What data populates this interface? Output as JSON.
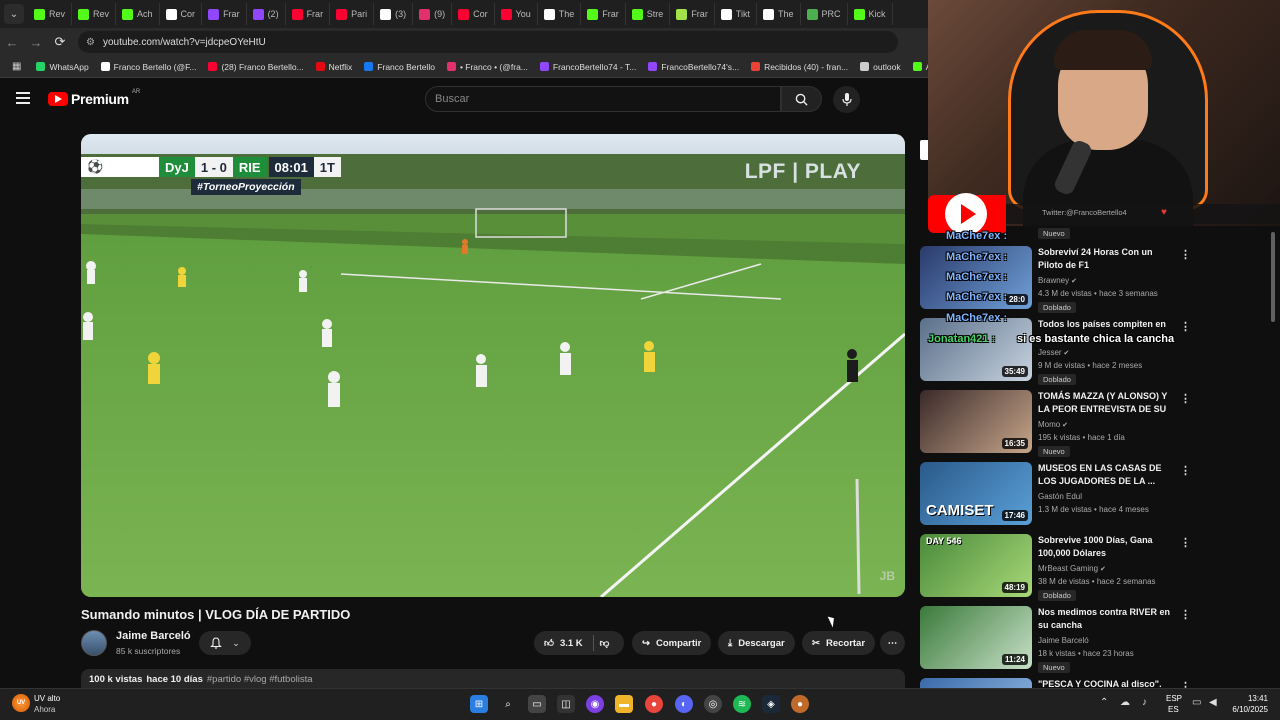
{
  "browser": {
    "tabs": [
      {
        "label": "Rev",
        "color": "#53fc18"
      },
      {
        "label": "Rev",
        "color": "#53fc18"
      },
      {
        "label": "Ach",
        "color": "#53fc18"
      },
      {
        "label": "Cor",
        "color": "#ffffff"
      },
      {
        "label": "Frar",
        "color": "#9146ff"
      },
      {
        "label": "(2)",
        "color": "#9146ff"
      },
      {
        "label": "Frar",
        "color": "#ff0033"
      },
      {
        "label": "Pari",
        "color": "#ff0033"
      },
      {
        "label": "(3)",
        "color": "#ffffff"
      },
      {
        "label": "(9)",
        "color": "#e1306c"
      },
      {
        "label": "Cor",
        "color": "#ff0033"
      },
      {
        "label": "You",
        "color": "#ff0033"
      },
      {
        "label": "The",
        "color": "#ffffff"
      },
      {
        "label": "Frar",
        "color": "#53fc18"
      },
      {
        "label": "Stre",
        "color": "#53fc18"
      },
      {
        "label": "Frar",
        "color": "#a4e24a"
      },
      {
        "label": "Tikt",
        "color": "#ffffff"
      },
      {
        "label": "The",
        "color": "#ffffff"
      },
      {
        "label": "PRC",
        "color": "#4caf50"
      },
      {
        "label": "Kick",
        "color": "#53fc18"
      }
    ],
    "url": "youtube.com/watch?v=jdcpeOYeHtU",
    "bookmarks": [
      {
        "label": "WhatsApp",
        "color": "#25d366"
      },
      {
        "label": "Franco Bertello (@F...",
        "color": "#ffffff"
      },
      {
        "label": "(28) Franco Bertello...",
        "color": "#ff0033"
      },
      {
        "label": "Netflix",
        "color": "#e50914"
      },
      {
        "label": "Franco Bertello",
        "color": "#1877f2"
      },
      {
        "label": "• Franco • (@fra...",
        "color": "#e1306c"
      },
      {
        "label": "FrancoBertello74 - T...",
        "color": "#9146ff"
      },
      {
        "label": "FrancoBertello74's...",
        "color": "#9146ff"
      },
      {
        "label": "Recibidos (40) - fran...",
        "color": "#ea4335"
      },
      {
        "label": "outlook",
        "color": "#cccccc"
      },
      {
        "label": "Aler",
        "color": "#53fc18"
      }
    ]
  },
  "youtube": {
    "logo_word": "Premium",
    "logo_country": "AR",
    "search_placeholder": "Buscar",
    "accent": "#ff0000"
  },
  "video": {
    "scorebug": {
      "home": "DyJ",
      "score": "1 - 0",
      "away": "RIE",
      "clock": "08:01",
      "period": "1T"
    },
    "hashtag": "#TorneoProyección",
    "broadcaster": "LPF | PLAY",
    "watermark": "JB",
    "title": "Sumando minutos | VLOG DÍA DE PARTIDO",
    "channel": "Jaime Barceló",
    "subscribers": "85 k suscriptores",
    "likes": "3.1 K",
    "share_label": "Compartir",
    "download_label": "Descargar",
    "clip_label": "Recortar",
    "views": "100 k vistas",
    "age": "hace 10 días",
    "tags": "#partido #vlog #futbolista"
  },
  "recommended": [
    {
      "title": "Sobreviví 24 Horas Con un Piloto de F1",
      "channel": "Brawney",
      "verified": true,
      "views": "4.3 M de vistas",
      "age": "hace 3 semanas",
      "duration": "28:0",
      "badge": "Doblado",
      "thumb": [
        "#2b3a6b",
        "#6fa0d8"
      ]
    },
    {
      "title": "Todos los países compiten en",
      "channel": "Jesser",
      "verified": true,
      "views": "9 M de vistas",
      "age": "hace 2 meses",
      "duration": "35:49",
      "badge": "Doblado",
      "thumb": [
        "#5a6f8a",
        "#c8d3df"
      ]
    },
    {
      "title": "TOMÁS MAZZA (Y ALONSO) Y LA PEOR ENTREVISTA DE SU ...",
      "channel": "Momo",
      "verified": true,
      "views": "195 k vistas",
      "age": "hace 1 día",
      "duration": "16:35",
      "badge": "Nuevo",
      "thumb": [
        "#3b2a2a",
        "#c7a68a"
      ]
    },
    {
      "title": "MUSEOS EN LAS CASAS DE LOS JUGADORES DE LA ...",
      "channel": "Gastón Edul",
      "verified": false,
      "views": "1.3 M de vistas",
      "age": "hace 4 meses",
      "duration": "17:46",
      "badge": "",
      "thumb": [
        "#2a5a8a",
        "#5aa0d8"
      ],
      "thumb_text": "CAMISET"
    },
    {
      "title": "Sobrevive 1000 Días, Gana 100,000 Dólares",
      "channel": "MrBeast Gaming",
      "verified": true,
      "views": "38 M de vistas",
      "age": "hace 2 semanas",
      "duration": "48:19",
      "badge": "Doblado",
      "thumb": [
        "#4a8a3a",
        "#a8d878"
      ],
      "thumb_text": "DAY 546"
    },
    {
      "title": "Nos medimos contra RIVER en su cancha",
      "channel": "Jaime Barceló",
      "verified": false,
      "views": "18 k vistas",
      "age": "hace 23 horas",
      "duration": "11:24",
      "badge": "Nuevo",
      "thumb": [
        "#3a7a3a",
        "#c8e0c8"
      ]
    },
    {
      "title": "\"PESCA Y COCINA al disco\".",
      "channel": "",
      "verified": false,
      "views": "",
      "age": "",
      "duration": "",
      "badge": "",
      "thumb": [
        "#3a6aa8",
        "#9ac0e8"
      ]
    }
  ],
  "top_badge": "Nuevo",
  "stream_overlay": {
    "twitter": "Twitter:@FrancoBertello4",
    "chat": [
      {
        "user": "MaChe7ex :",
        "color": "#7fb5ff"
      },
      {
        "user": "MaChe7ex :",
        "color": "#7fb5ff"
      },
      {
        "user": "MaChe7ex :",
        "color": "#7fb5ff"
      },
      {
        "user": "MaChe7ex :",
        "color": "#7fb5ff"
      },
      {
        "user": "MaChe7ex :",
        "color": "#7fb5ff"
      },
      {
        "user": "Jonatan421 :",
        "color": "#4bd46b"
      }
    ],
    "chat_message": "si es bastante chica la cancha"
  },
  "taskbar": {
    "weather_icon_text": "UV",
    "weather_line1": "UV alto",
    "weather_line2": "Ahora",
    "lang1": "ESP",
    "lang2": "ES",
    "time": "13:41",
    "date": "6/10/2025"
  }
}
